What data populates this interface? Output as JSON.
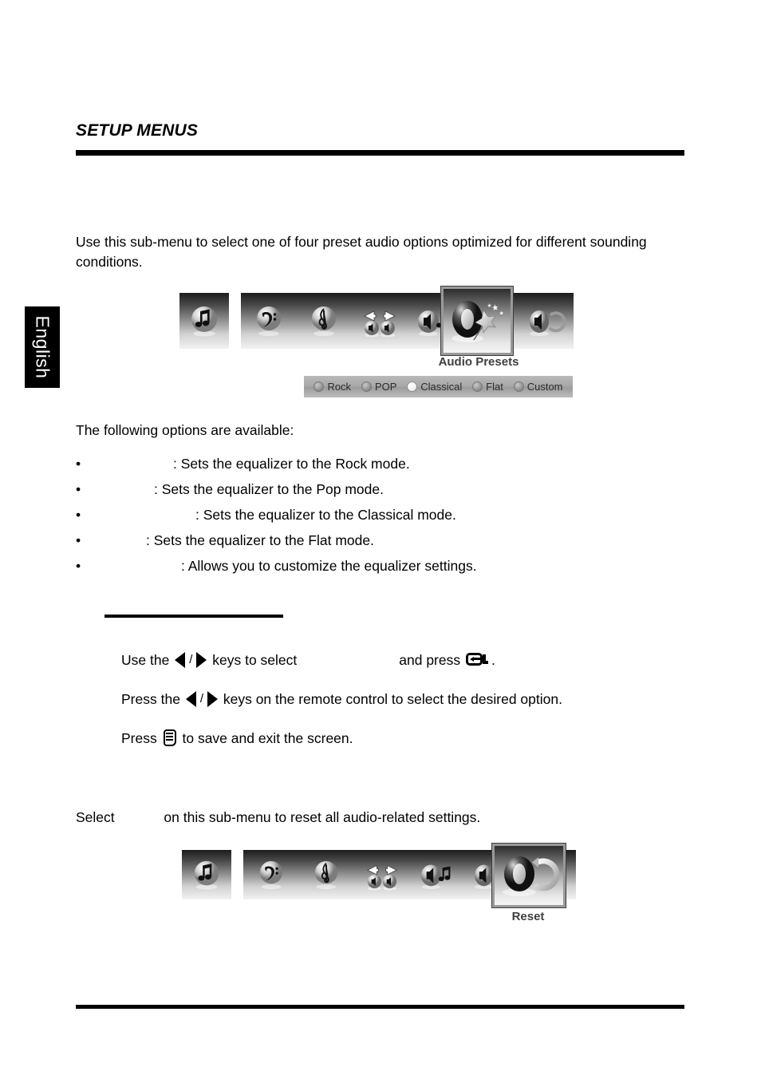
{
  "header": {
    "title": "SETUP MENUS"
  },
  "language_tab": {
    "label": "English"
  },
  "intro": {
    "text": "Use this sub-menu to select one of four preset audio options optimized for different sounding conditions."
  },
  "osd_audio_presets": {
    "caption": "Audio Presets",
    "icons": [
      {
        "name": "music-note-icon",
        "title": "Sound"
      },
      {
        "name": "bass-clef-icon",
        "title": "Bass"
      },
      {
        "name": "treble-clef-icon",
        "title": "Treble"
      },
      {
        "name": "balance-icon",
        "title": "Balance"
      },
      {
        "name": "audio-mode-icon",
        "title": "Audio Mode"
      },
      {
        "name": "audio-presets-icon",
        "title": "Audio Presets"
      },
      {
        "name": "reset-icon",
        "title": "Reset"
      }
    ],
    "selected_icon": "audio-presets-icon",
    "options": [
      {
        "label": "Rock",
        "selected": false
      },
      {
        "label": "POP",
        "selected": false
      },
      {
        "label": "Classical",
        "selected": true
      },
      {
        "label": "Flat",
        "selected": false
      },
      {
        "label": "Custom",
        "selected": false
      }
    ]
  },
  "options_section": {
    "lead": "The following options are available:",
    "bullet": "•",
    "items": [
      {
        "term": "",
        "term_width": "term-rock",
        "description": ": Sets the equalizer to the Rock mode."
      },
      {
        "term": "",
        "term_width": "term-pop",
        "description": ": Sets the equalizer to the Pop mode."
      },
      {
        "term": "",
        "term_width": "term-classical",
        "description": ": Sets the equalizer to the Classical mode."
      },
      {
        "term": "",
        "term_width": "term-flat",
        "description": ": Sets the equalizer to the Flat mode."
      },
      {
        "term": "",
        "term_width": "term-custom",
        "description": ": Allows you to customize the equalizer settings."
      }
    ]
  },
  "instructions": {
    "line1_a": "Use the",
    "line1_b": "keys to select",
    "line1_c": "and press",
    "line1_d": ".",
    "line2_a": "Press the",
    "line2_b": "keys on the remote control to select the desired option.",
    "line3_a": "Press",
    "line3_b": "to save and exit the screen.",
    "separator": "/"
  },
  "reset_section": {
    "lead_a": "Select",
    "lead_b": "on this sub-menu to reset all audio-related settings.",
    "caption": "Reset",
    "selected_icon": "reset-icon"
  }
}
